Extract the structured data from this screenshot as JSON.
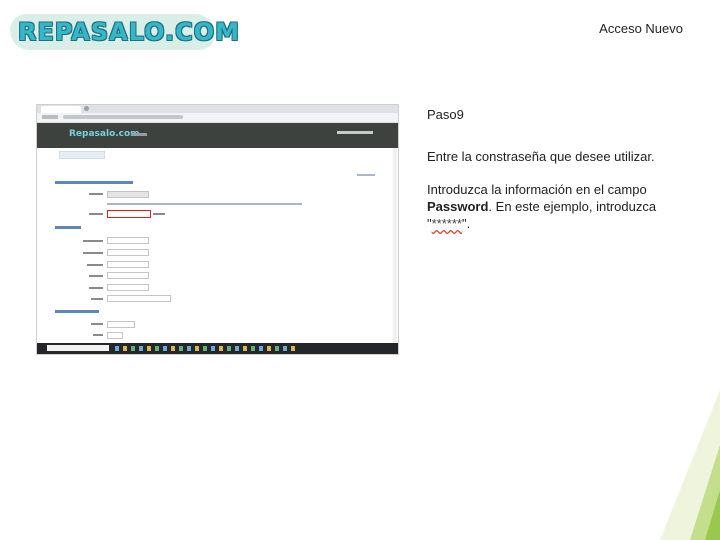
{
  "logo": {
    "text": "REPASALO.COM"
  },
  "slide": {
    "title": "Acceso Nuevo"
  },
  "instructions": {
    "step": "Paso9",
    "line1": "Entre la constraseña que desee utilizar.",
    "line2_pre": "Introduzca la información en el campo ",
    "line2_keyword": "Password",
    "line2_mid": ". En este ejemplo, introduzca \"",
    "line2_password": "******",
    "line2_post": "\"."
  },
  "screenshot": {
    "site_logo": "Repasalo.com",
    "highlighted_field": "password-field"
  },
  "colors": {
    "logo_teal": "#35b6c9",
    "logo_outline": "#1e6f7d",
    "site_header": "#3d423f",
    "highlight_red": "#e01e1e",
    "section_blue": "#5e86b8",
    "deco_green": "#9ac84f"
  }
}
